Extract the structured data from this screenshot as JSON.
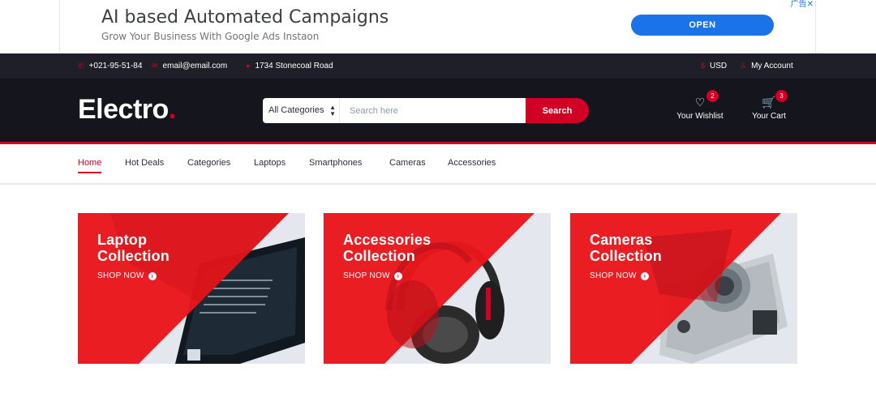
{
  "ad": {
    "title": "AI based Automated Campaigns",
    "subtitle": "Grow Your Business With Google Ads Instaon",
    "open_label": "OPEN",
    "corner": "广告✕"
  },
  "top_header": {
    "phone": "+021-95-51-84",
    "email": "email@email.com",
    "address": "1734 Stonecoal Road",
    "currency": "USD",
    "account": "My Account",
    "icons": {
      "phone": "phone-icon",
      "email": "envelope-icon",
      "address": "map-marker-icon",
      "currency": "dollar-icon",
      "account": "user-icon"
    }
  },
  "header": {
    "logo_text": "Electro",
    "logo_dot": ".",
    "category_selected": "All Categories",
    "search_placeholder": "Search here",
    "search_button": "Search",
    "wishlist_label": "Your Wishlist",
    "wishlist_count": "2",
    "cart_label": "Your Cart",
    "cart_count": "3"
  },
  "nav": {
    "items": [
      "Home",
      "Hot Deals",
      "Categories",
      "Laptops",
      "Smartphones",
      "Cameras",
      "Accessories"
    ]
  },
  "collections": [
    {
      "line1": "Laptop",
      "line2": "Collection",
      "cta": "SHOP NOW",
      "image": "laptop"
    },
    {
      "line1": "Accessories",
      "line2": "Collection",
      "cta": "SHOP NOW",
      "image": "headphones"
    },
    {
      "line1": "Cameras",
      "line2": "Collection",
      "cta": "SHOP NOW",
      "image": "camera"
    }
  ],
  "colors": {
    "accent": "#D10024",
    "top_header_bg": "#1E1F29",
    "header_bg": "#15161D",
    "ad_button": "#1A73E8"
  }
}
